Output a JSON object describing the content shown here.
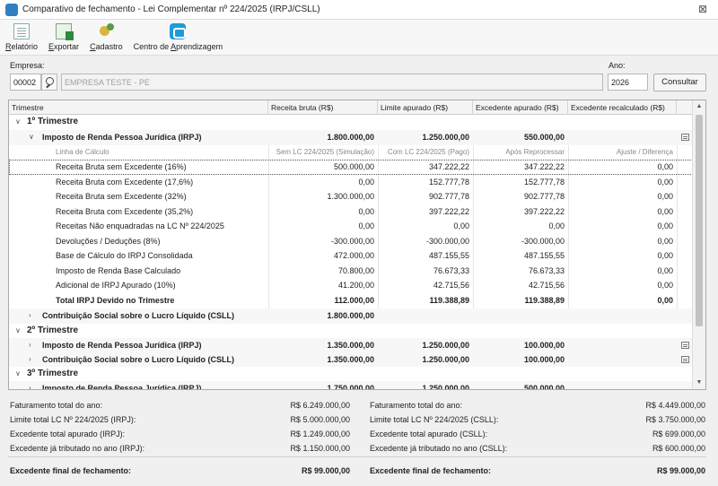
{
  "window": {
    "title": "Comparativo de fechamento - Lei Complementar nº 224/2025 (IRPJ/CSLL)",
    "close_symbol": "⊠"
  },
  "toolbar": {
    "relatorio": {
      "pre": "",
      "u": "R",
      "post": "elatório"
    },
    "exportar": {
      "pre": "",
      "u": "E",
      "post": "xportar"
    },
    "cadastro": {
      "pre": "",
      "u": "C",
      "post": "adastro"
    },
    "centro": {
      "pre": "Centro de ",
      "u": "A",
      "post": "prendizagem"
    }
  },
  "form": {
    "empresa_label": "Empresa:",
    "empresa_code": "00002",
    "empresa_name": "EMPRESA TESTE - PE",
    "ano_label": "Ano:",
    "ano_value": "2026",
    "consultar_label": "Consultar"
  },
  "grid": {
    "headers": [
      "Trimestre",
      "Receita bruta (R$)",
      "Limite apurado (R$)",
      "Excedente apurado (R$)",
      "Excedente recalculado (R$)"
    ],
    "q1": {
      "label": "1º Trimestre"
    },
    "q1_irpj": {
      "label": "Imposto de Renda Pessoa Jurídica (IRPJ)",
      "receita": "1.800.000,00",
      "limite": "1.250.000,00",
      "excedente": "550.000,00"
    },
    "calc_head": {
      "linha": "Linha de Cálculo",
      "sem": "Sem LC 224/2025 (Simulação)",
      "com": "Com LC 224/2025 (Pago)",
      "apos": "Após Reprocessar",
      "ajuste": "Ajuste / Diferença"
    },
    "lines": [
      {
        "label": "Receita Bruta sem Excedente (16%)",
        "sem": "500.000,00",
        "com": "347.222,22",
        "apos": "347.222,22",
        "ajuste": "0,00"
      },
      {
        "label": "Receita Bruta com Excedente (17,6%)",
        "sem": "0,00",
        "com": "152.777,78",
        "apos": "152.777,78",
        "ajuste": "0,00"
      },
      {
        "label": "Receita Bruta sem Excedente (32%)",
        "sem": "1.300.000,00",
        "com": "902.777,78",
        "apos": "902.777,78",
        "ajuste": "0,00"
      },
      {
        "label": "Receita Bruta com Excedente (35,2%)",
        "sem": "0,00",
        "com": "397.222,22",
        "apos": "397.222,22",
        "ajuste": "0,00"
      },
      {
        "label": "Receitas Não enquadradas na LC Nº 224/2025",
        "sem": "0,00",
        "com": "0,00",
        "apos": "0,00",
        "ajuste": "0,00"
      },
      {
        "label": "Devoluções / Deduções (8%)",
        "sem": "-300.000,00",
        "com": "-300.000,00",
        "apos": "-300.000,00",
        "ajuste": "0,00"
      },
      {
        "label": "Base de Cálculo do IRPJ Consolidada",
        "sem": "472.000,00",
        "com": "487.155,55",
        "apos": "487.155,55",
        "ajuste": "0,00"
      },
      {
        "label": "Imposto de Renda Base Calculado",
        "sem": "70.800,00",
        "com": "76.673,33",
        "apos": "76.673,33",
        "ajuste": "0,00"
      },
      {
        "label": "Adicional de IRPJ Apurado (10%)",
        "sem": "41.200,00",
        "com": "42.715,56",
        "apos": "42.715,56",
        "ajuste": "0,00"
      },
      {
        "label": "Total IRPJ Devido no Trimestre",
        "sem": "112.000,00",
        "com": "119.388,89",
        "apos": "119.388,89",
        "ajuste": "0,00"
      }
    ],
    "q1_csll": {
      "label": "Contribuição Social sobre o Lucro Líquido (CSLL)",
      "receita": "1.800.000,00"
    },
    "q2": {
      "label": "2º Trimestre"
    },
    "q2_irpj": {
      "label": "Imposto de Renda Pessoa Jurídica (IRPJ)",
      "receita": "1.350.000,00",
      "limite": "1.250.000,00",
      "excedente": "100.000,00"
    },
    "q2_csll": {
      "label": "Contribuição Social sobre o Lucro Líquido (CSLL)",
      "receita": "1.350.000,00",
      "limite": "1.250.000,00",
      "excedente": "100.000,00"
    },
    "q3": {
      "label": "3º Trimestre"
    },
    "q3_irpj": {
      "label": "Imposto de Renda Pessoa Jurídica (IRPJ)",
      "receita": "1.750.000,00",
      "limite": "1.250.000,00",
      "excedente": "500.000,00"
    }
  },
  "summary": {
    "left": [
      {
        "label": "Faturamento total do ano:",
        "value": "R$ 6.249.000,00"
      },
      {
        "label": "Limite total LC Nº 224/2025 (IRPJ):",
        "value": "R$ 5.000.000,00"
      },
      {
        "label": "Excedente total apurado (IRPJ):",
        "value": "R$ 1.249.000,00"
      },
      {
        "label": "Excedente já tributado no ano (IRPJ):",
        "value": "R$ 1.150.000,00"
      }
    ],
    "right": [
      {
        "label": "Faturamento total do ano:",
        "value": "R$ 4.449.000,00"
      },
      {
        "label": "Limite total LC Nº 224/2025 (CSLL):",
        "value": "R$ 3.750.000,00"
      },
      {
        "label": "Excedente total apurado (CSLL):",
        "value": "R$ 699.000,00"
      },
      {
        "label": "Excedente já tributado no ano (CSLL):",
        "value": "R$ 600.000,00"
      }
    ],
    "final_left": {
      "label": "Excedente final de fechamento:",
      "value": "R$ 99.000,00"
    },
    "final_right": {
      "label": "Excedente final de fechamento:",
      "value": "R$ 99.000,00"
    }
  }
}
